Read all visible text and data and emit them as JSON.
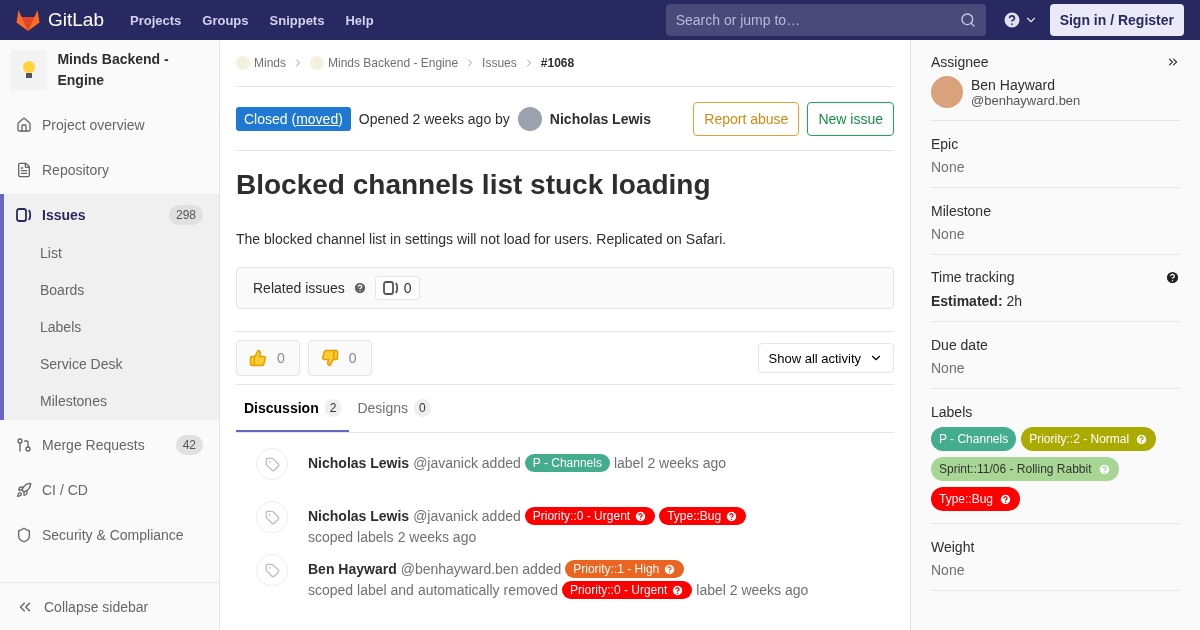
{
  "topbar": {
    "brand": "GitLab",
    "nav": [
      "Projects",
      "Groups",
      "Snippets",
      "Help"
    ],
    "search": {
      "placeholder": "Search or jump to…"
    },
    "sign_in": "Sign in / Register"
  },
  "sidebar": {
    "project": "Minds Backend - Engine",
    "items": [
      {
        "kind": "home",
        "label": "Project overview",
        "selected": false
      },
      {
        "kind": "file",
        "label": "Repository",
        "selected": false
      },
      {
        "kind": "issues",
        "label": "Issues",
        "count": "298",
        "selected": true,
        "children": [
          {
            "label": "List",
            "selected": false
          },
          {
            "label": "Boards",
            "selected": false
          },
          {
            "label": "Labels",
            "selected": false
          },
          {
            "label": "Service Desk",
            "selected": false
          },
          {
            "label": "Milestones",
            "selected": false
          }
        ]
      },
      {
        "kind": "merge",
        "label": "Merge Requests",
        "count": "42",
        "selected": false
      },
      {
        "kind": "rocket",
        "label": "CI / CD",
        "selected": false
      },
      {
        "kind": "shield",
        "label": "Security & Compliance",
        "selected": false
      }
    ],
    "collapse": "Collapse sidebar"
  },
  "breadcrumb": [
    {
      "label": "Minds",
      "logo": true
    },
    {
      "label": "Minds Backend - Engine",
      "logo": true
    },
    {
      "label": "Issues",
      "logo": false
    },
    {
      "label": "#1068",
      "logo": false
    }
  ],
  "issue": {
    "status": "Closed",
    "link_open": "(",
    "status_link": "moved",
    "link_close": ")",
    "opened": "Opened 2 weeks ago by",
    "author": "Nicholas Lewis",
    "buttons": [
      {
        "kind": "warning",
        "label": "Report abuse"
      },
      {
        "kind": "success",
        "label": "New issue"
      }
    ],
    "title": "Blocked channels list stuck loading",
    "description": "The blocked channel list in settings will not load for users. Replicated on Safari.",
    "related": {
      "label": "Related issues",
      "count": "0"
    },
    "awards": [
      {
        "kind": "up",
        "count": "0"
      },
      {
        "kind": "down",
        "count": "0"
      }
    ],
    "activity_filter": "Show all activity",
    "tabs": [
      {
        "label": "Discussion",
        "count": "2",
        "selected": true
      },
      {
        "label": "Designs",
        "count": "0",
        "selected": false
      }
    ],
    "activity": [
      {
        "author": "Nicholas Lewis",
        "parts": [
          {
            "kind": "text",
            "text": "@javanick added"
          },
          {
            "kind": "label",
            "text": "P - Channels",
            "color": "#44ad8e",
            "scoped": false
          },
          {
            "kind": "text",
            "text": "label 2 weeks ago"
          }
        ]
      },
      {
        "author": "Nicholas Lewis",
        "parts": [
          {
            "kind": "text",
            "text": "@javanick added"
          },
          {
            "kind": "label",
            "text": "Priority::0 - Urgent",
            "color": "#ff0000",
            "scoped": true
          },
          {
            "kind": "label",
            "text": "Type::Bug",
            "color": "#ff0000",
            "scoped": true
          },
          {
            "kind": "text",
            "text": "scoped labels"
          },
          {
            "kind": "text",
            "text": "2 weeks ago"
          }
        ]
      },
      {
        "author": "Ben Hayward",
        "parts": [
          {
            "kind": "text",
            "text": "@benhayward.ben added"
          },
          {
            "kind": "label",
            "text": "Priority::1 - High",
            "color": "#eb6420",
            "scoped": true
          },
          {
            "kind": "text",
            "text": "scoped label and"
          },
          {
            "kind": "text",
            "text": "automatically removed"
          },
          {
            "kind": "label",
            "text": "Priority::0 - Urgent",
            "color": "#ff0000",
            "scoped": true
          },
          {
            "kind": "text",
            "text": "label 2 weeks ago"
          }
        ]
      }
    ]
  },
  "right_sidebar": {
    "assignee": {
      "heading": "Assignee",
      "name": "Ben Hayward",
      "handle": "@benhayward.ben"
    },
    "sections": [
      {
        "heading": "Epic",
        "value": "None"
      },
      {
        "heading": "Milestone",
        "value": "None"
      }
    ],
    "time_tracking": {
      "heading": "Time tracking",
      "key": "Estimated:",
      "value": "2h"
    },
    "due": {
      "heading": "Due date",
      "value": "None"
    },
    "labels": {
      "heading": "Labels",
      "items": [
        {
          "text": "P - Channels",
          "color": "#44ad8e",
          "scoped": false
        },
        {
          "text": "Priority::2 - Normal",
          "color": "#aaaa00",
          "scoped": true
        },
        {
          "text": "Sprint::11/06 - Rolling Rabbit",
          "color": "#a8d695",
          "scoped": true
        },
        {
          "text": "Type::Bug",
          "color": "#ff0000",
          "scoped": true
        }
      ]
    },
    "weight": {
      "heading": "Weight",
      "value": "None"
    }
  }
}
